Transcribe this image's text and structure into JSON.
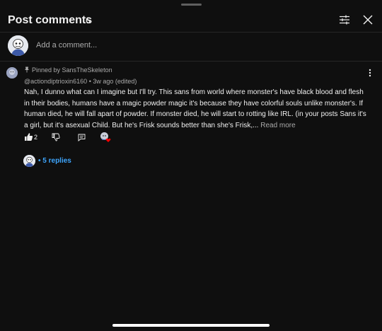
{
  "header": {
    "title": "Post comments",
    "count": "6"
  },
  "compose": {
    "placeholder": "Add a comment..."
  },
  "comment": {
    "pinned_text": "Pinned by SansTheSkeleton",
    "author": "@actiondiptrioxin6160",
    "separator": "•",
    "time": "3w ago (edited)",
    "text": "Nah, I dunno what can I imagine but I'll try. This sans from world where monster's have black blood and flesh in their bodies, humans have a magic powder magic it's because they have colorful souls unlike monster's. If human died, he will fall apart of powder. If monster died, he will start to rotting like IRL. (in your posts Sans it's a girl, but it's asexual Child. But he's Frisk sounds better than she's Frisk,...",
    "read_more": "Read more",
    "likes": "2"
  },
  "replies": {
    "label": "• 5 replies"
  },
  "icons": {
    "filter": "sliders-icon",
    "close": "close-icon",
    "pin": "pin-icon",
    "more": "kebab-icon",
    "like": "thumbs-up-icon",
    "dislike": "thumbs-down-icon",
    "reply": "comment-icon",
    "heart": "creator-heart-icon"
  },
  "colors": {
    "background": "#0f0f0f",
    "text": "#f1f1f1",
    "secondary": "#aaaaaa",
    "link": "#3ea6ff",
    "heart": "#ff0000"
  }
}
